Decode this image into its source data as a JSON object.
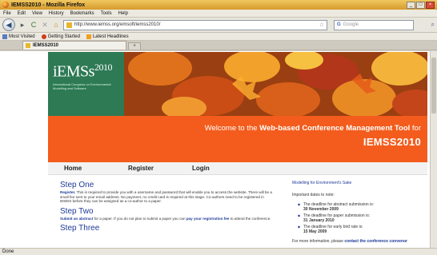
{
  "window": {
    "title": "IEMSS2010 - Mozilla Firefox",
    "min": "_",
    "max": "□",
    "close": "×"
  },
  "menu": [
    "File",
    "Edit",
    "View",
    "History",
    "Bookmarks",
    "Tools",
    "Help"
  ],
  "nav": {
    "url": "http://www.iemss.org/emsoft/iemss2010/",
    "search_placeholder": "Google",
    "back_glyph": "◀",
    "reload_glyph": "C",
    "stop_glyph": "✕",
    "home_glyph": "⌂",
    "star_glyph": "☆",
    "search_glyph": "⌕"
  },
  "bookmarks": [
    "Most Visited",
    "Getting Started",
    "Latest Headlines"
  ],
  "tab": {
    "label": "IEMSS2010",
    "new_tab": "+"
  },
  "site": {
    "logo_main": "iEMSs",
    "logo_year": "2010",
    "logo_sub": "International Congress on Environmental Modelling and Software",
    "welcome_prefix": "Welcome to the ",
    "welcome_bold": "Web-based Conference Management Tool",
    "welcome_suffix": " for",
    "conf": "IEMSS2010",
    "nav": [
      "Home",
      "Register",
      "Login"
    ],
    "steps": [
      {
        "title": "Step One",
        "lead": "Register.",
        "text": " This is required to provide you with a username and password that will enable you to access the website. There will be a small fee sent to your email address. No payment, no credit card is required at this stage. Co-authors need to be registered in IEMSS before they can be assigned as a co-author to a paper."
      },
      {
        "title": "Step Two",
        "lead": "Submit an abstract",
        "text": " for a paper. If you do not plan to submit a paper you can ",
        "tail": "pay your registration fee",
        "end": " to attend the conference."
      },
      {
        "title": "Step Three"
      }
    ],
    "right": {
      "title": "Modelling for Environment's Sake",
      "sub": "Important dates to note:",
      "dates": [
        {
          "text": "The deadline for abstract submission is:",
          "date": "30 November 2009"
        },
        {
          "text": "The deadline for paper submission is:",
          "date": "31 January 2010"
        },
        {
          "text": "The deadline for early bird rate is:",
          "date": "15 May 2009"
        }
      ],
      "more_prefix": "For more information, please ",
      "more_link": "contact the conference convenor"
    }
  },
  "status": "Done",
  "colors": {
    "orange": "#f35c1c",
    "logo_green": "#2d7a54",
    "link_blue": "#1e3a9a"
  }
}
